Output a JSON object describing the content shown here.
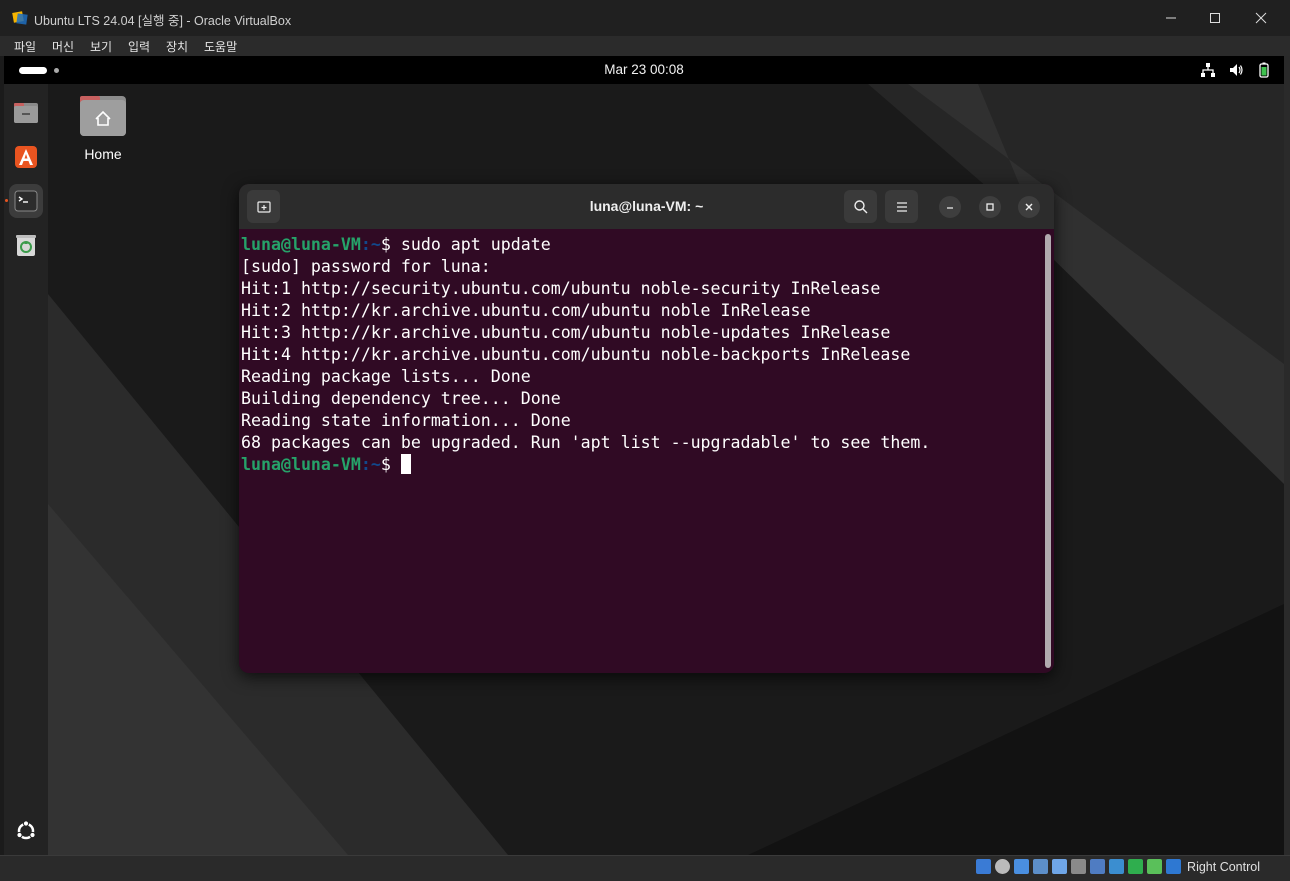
{
  "window": {
    "title": "Ubuntu LTS 24.04 [실행 중] - Oracle VirtualBox"
  },
  "menubar": [
    "파일",
    "머신",
    "보기",
    "입력",
    "장치",
    "도움말"
  ],
  "topbar": {
    "clock": "Mar 23  00:08"
  },
  "desktop": {
    "home_label": "Home"
  },
  "terminal": {
    "title": "luna@luna-VM: ~",
    "prompt_user": "luna@luna-VM",
    "prompt_path": ":~",
    "prompt_sign": "$ ",
    "command": "sudo apt update",
    "output": [
      "[sudo] password for luna:",
      "Hit:1 http://security.ubuntu.com/ubuntu noble-security InRelease",
      "Hit:2 http://kr.archive.ubuntu.com/ubuntu noble InRelease",
      "Hit:3 http://kr.archive.ubuntu.com/ubuntu noble-updates InRelease",
      "Hit:4 http://kr.archive.ubuntu.com/ubuntu noble-backports InRelease",
      "Reading package lists... Done",
      "Building dependency tree... Done",
      "Reading state information... Done",
      "68 packages can be upgraded. Run 'apt list --upgradable' to see them."
    ]
  },
  "statusbar": {
    "host_key": "Right Control"
  },
  "colors": {
    "terminal_bg": "#300a24",
    "prompt_user": "#26a269",
    "prompt_path": "#12488b",
    "ubuntu_orange": "#e95420"
  }
}
